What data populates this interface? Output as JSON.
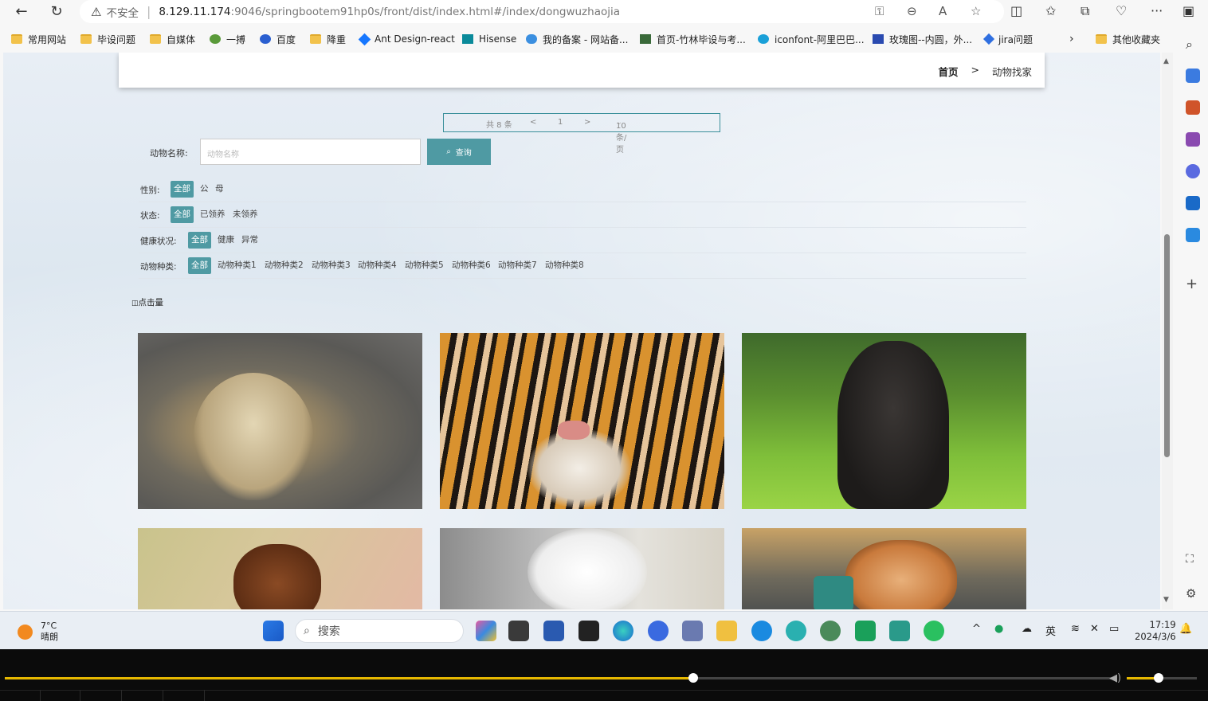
{
  "browser": {
    "insecure_label": "不安全",
    "url_host": "8.129.11.174",
    "url_path": ":9046/springbootem91hp0s/front/dist/index.html#/index/dongwuzhaojia",
    "bookmarks": [
      {
        "label": "常用网站",
        "icon": "folder-icon"
      },
      {
        "label": "毕设问题",
        "icon": "folder-icon"
      },
      {
        "label": "自媒体",
        "icon": "folder-icon"
      },
      {
        "label": "一搏",
        "icon": "site-icon"
      },
      {
        "label": "百度",
        "icon": "baidu-icon"
      },
      {
        "label": "降重",
        "icon": "folder-icon"
      },
      {
        "label": "Ant Design-react",
        "icon": "antd-icon"
      },
      {
        "label": "Hisense",
        "icon": "hisense-icon"
      },
      {
        "label": "我的备案 - 网站备...",
        "icon": "cloud-icon"
      },
      {
        "label": "首页-竹林毕设与考...",
        "icon": "site-icon"
      },
      {
        "label": "iconfont-阿里巴巴...",
        "icon": "iconfont-icon"
      },
      {
        "label": "玫瑰图--内圆，外...",
        "icon": "chart-icon"
      },
      {
        "label": "jira问题",
        "icon": "jira-icon"
      }
    ],
    "other_bookmarks": "其他收藏夹"
  },
  "page": {
    "breadcrumb_home": "首页",
    "breadcrumb_sep": ">",
    "breadcrumb_current": "动物找家",
    "pager": {
      "total": "共 8 条",
      "prev": "<",
      "page": "1",
      "next": ">",
      "size": "10条/页"
    },
    "search_label": "动物名称:",
    "search_placeholder": "动物名称",
    "search_button": "查询",
    "filters": [
      {
        "label": "性别:",
        "options": [
          "全部",
          "公",
          "母"
        ]
      },
      {
        "label": "状态:",
        "options": [
          "全部",
          "已领养",
          "未领养"
        ]
      },
      {
        "label": "健康状况:",
        "options": [
          "全部",
          "健康",
          "异常"
        ]
      },
      {
        "label": "动物种类:",
        "options": [
          "全部",
          "动物种类1",
          "动物种类2",
          "动物种类3",
          "动物种类4",
          "动物种类5",
          "动物种类6",
          "动物种类7",
          "动物种类8"
        ]
      }
    ],
    "sort_label": "点击量",
    "animals": [
      "duckling",
      "tiger",
      "black cat",
      "dachshund",
      "pomeranian",
      "shiba inu"
    ]
  },
  "taskbar": {
    "temperature": "7°C",
    "weather": "晴朗",
    "search_placeholder": "搜索",
    "ime": "英",
    "time": "17:19",
    "date": "2024/3/6"
  },
  "media": {
    "progress": 0.62,
    "volume": 0.45
  },
  "colors": {
    "accent": "#4f9aa3",
    "progress": "#e6b800"
  }
}
